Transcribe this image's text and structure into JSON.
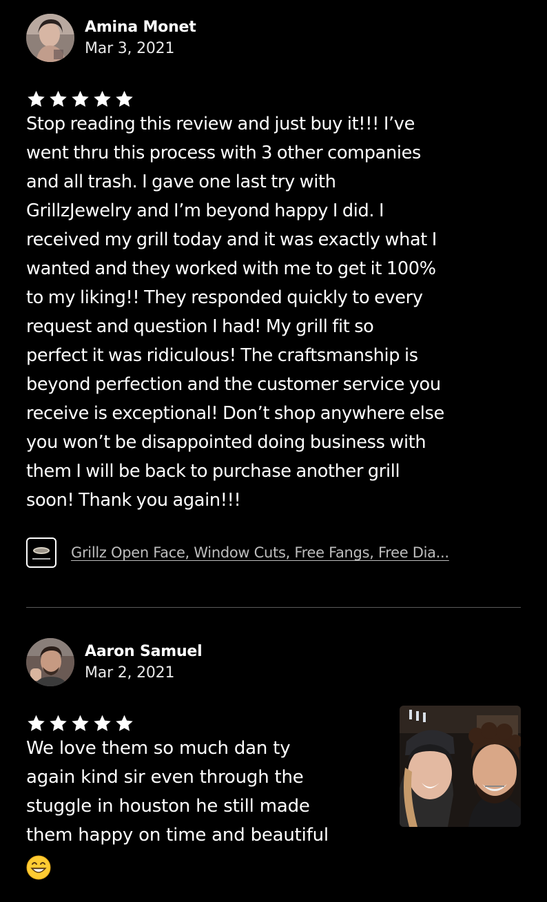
{
  "reviews": [
    {
      "author": "Amina Monet",
      "date": "Mar 3, 2021",
      "rating": 5,
      "text": "Stop reading this review and just buy it!!! I’ve\nwent thru this process with 3 other companies\nand all trash. I gave one last try with\nGrillzJewelry and I’m beyond happy I did. I\nreceived my grill today and it was exactly what I\nwanted and they worked with me to get it 100%\nto my liking!! They responded quickly to every\nrequest and question I had!  My grill fit so\nperfect it was ridiculous! The craftsmanship is\nbeyond perfection and the customer service you\nreceive is exceptional! Don’t shop anywhere else\nyou won’t be disappointed doing business with\nthem I will be back to purchase another grill\nsoon! Thank you again!!!",
      "listing_title": "Grillz Open Face, Window Cuts, Free Fangs, Free Dia...",
      "avatar_icon": "user-avatar-photo",
      "listing_icon": "grillz-thumbnail-icon"
    },
    {
      "author": "Aaron Samuel",
      "date": "Mar 2, 2021",
      "rating": 5,
      "text": "We love them so much dan ty\nagain kind sir even through the\nstuggle in houston he still made\nthem happy on time and beautiful",
      "emoji": "grinning-face-emoji",
      "avatar_icon": "user-avatar-photo",
      "photo_icon": "review-photo"
    }
  ],
  "colors": {
    "background": "#000000",
    "text": "#ffffff",
    "link": "#bdbdbd",
    "divider": "#5a5a5a",
    "star": "#ffffff"
  }
}
